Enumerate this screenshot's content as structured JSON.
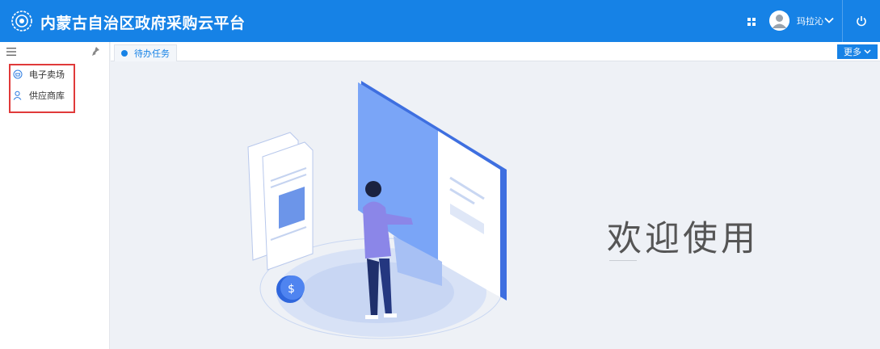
{
  "header": {
    "title": "内蒙古自治区政府采购云平台",
    "user_name": "玛拉沁",
    "icons": [
      "platform-logo-icon",
      "apps-grid-icon",
      "user-avatar",
      "chevron-down-icon",
      "power-icon"
    ]
  },
  "sidebar": {
    "toolbar_icons": [
      "menu-toggle-icon",
      "pin-icon"
    ],
    "items": [
      {
        "label": "电子卖场",
        "icon": "store-icon"
      },
      {
        "label": "供应商库",
        "icon": "supplier-icon"
      }
    ]
  },
  "tabs": {
    "active_label": "待办任务",
    "more_label": "更多"
  },
  "main": {
    "welcome_text": "欢迎使用",
    "illustration_icon": "dollar-coin-icon",
    "coin_symbol": "$"
  },
  "colors": {
    "primary": "#1682e6",
    "highlight_border": "#e03a3a",
    "background": "#eef1f6"
  }
}
